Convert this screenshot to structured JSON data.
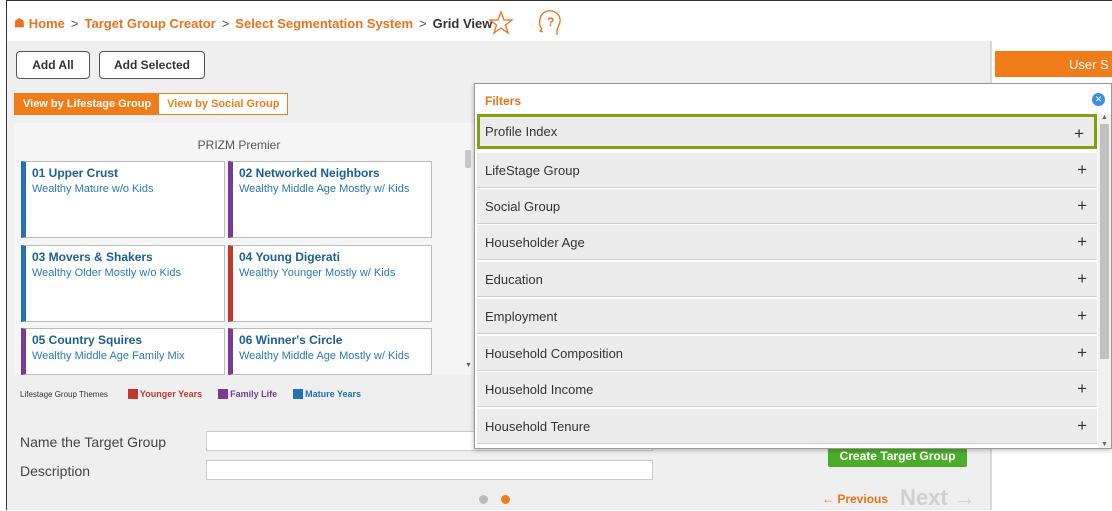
{
  "breadcrumb": {
    "home": "Home",
    "target_group_creator": "Target Group Creator",
    "select_segmentation": "Select Segmentation System",
    "current": "Grid View",
    "separator": ">"
  },
  "icons": {
    "home": "home-icon",
    "favorite": "star-icon",
    "help": "help-icon",
    "close": "close-icon",
    "expand": "plus-icon"
  },
  "toolbar": {
    "add_all": "Add All",
    "add_selected": "Add Selected"
  },
  "view_toggle": {
    "lifestage": "View by Lifestage Group",
    "social": "View by Social Group"
  },
  "right_panel": {
    "tab_label": "User S"
  },
  "grid": {
    "title": "PRIZM Premier",
    "segments": [
      {
        "title": "01 Upper Crust",
        "subtitle": "Wealthy Mature w/o Kids",
        "color": "#2272b4"
      },
      {
        "title": "02 Networked Neighbors",
        "subtitle": "Wealthy Middle Age Mostly w/ Kids",
        "color": "#7a3a96"
      },
      {
        "title": "03 Movers & Shakers",
        "subtitle": "Wealthy Older Mostly w/o Kids",
        "color": "#2272b4"
      },
      {
        "title": "04 Young Digerati",
        "subtitle": "Wealthy Younger Mostly w/ Kids",
        "color": "#c0392b"
      },
      {
        "title": "05 Country Squires",
        "subtitle": "Wealthy Middle Age Family Mix",
        "color": "#7a3a96"
      },
      {
        "title": "06 Winner's Circle",
        "subtitle": "Wealthy Middle Age Mostly w/ Kids",
        "color": "#7a3a96"
      }
    ]
  },
  "legend": {
    "title": "Lifestage Group Themes",
    "items": [
      {
        "label": "Younger Years",
        "color": "#c0392b"
      },
      {
        "label": "Family Life",
        "color": "#7a3a96"
      },
      {
        "label": "Mature Years",
        "color": "#2272b4"
      }
    ]
  },
  "form": {
    "name_label": "Name the Target Group",
    "name_value": "",
    "description_label": "Description",
    "description_value": ""
  },
  "actions": {
    "create": "Create Target Group",
    "previous": "← Previous",
    "next": "Next →"
  },
  "pagination": {
    "current": 2,
    "total": 2
  },
  "colors": {
    "brand_orange": "#f07c1a",
    "green": "#4cac2a",
    "highlight": "#7ea20f"
  },
  "filters": {
    "title": "Filters",
    "items": [
      {
        "label": "Profile Index",
        "selected": true
      },
      {
        "label": "LifeStage Group",
        "selected": false
      },
      {
        "label": "Social Group",
        "selected": false
      },
      {
        "label": "Householder Age",
        "selected": false
      },
      {
        "label": "Education",
        "selected": false
      },
      {
        "label": "Employment",
        "selected": false
      },
      {
        "label": "Household Composition",
        "selected": false
      },
      {
        "label": "Household Income",
        "selected": false
      },
      {
        "label": "Household Tenure",
        "selected": false
      }
    ],
    "plus_symbol": "+"
  }
}
